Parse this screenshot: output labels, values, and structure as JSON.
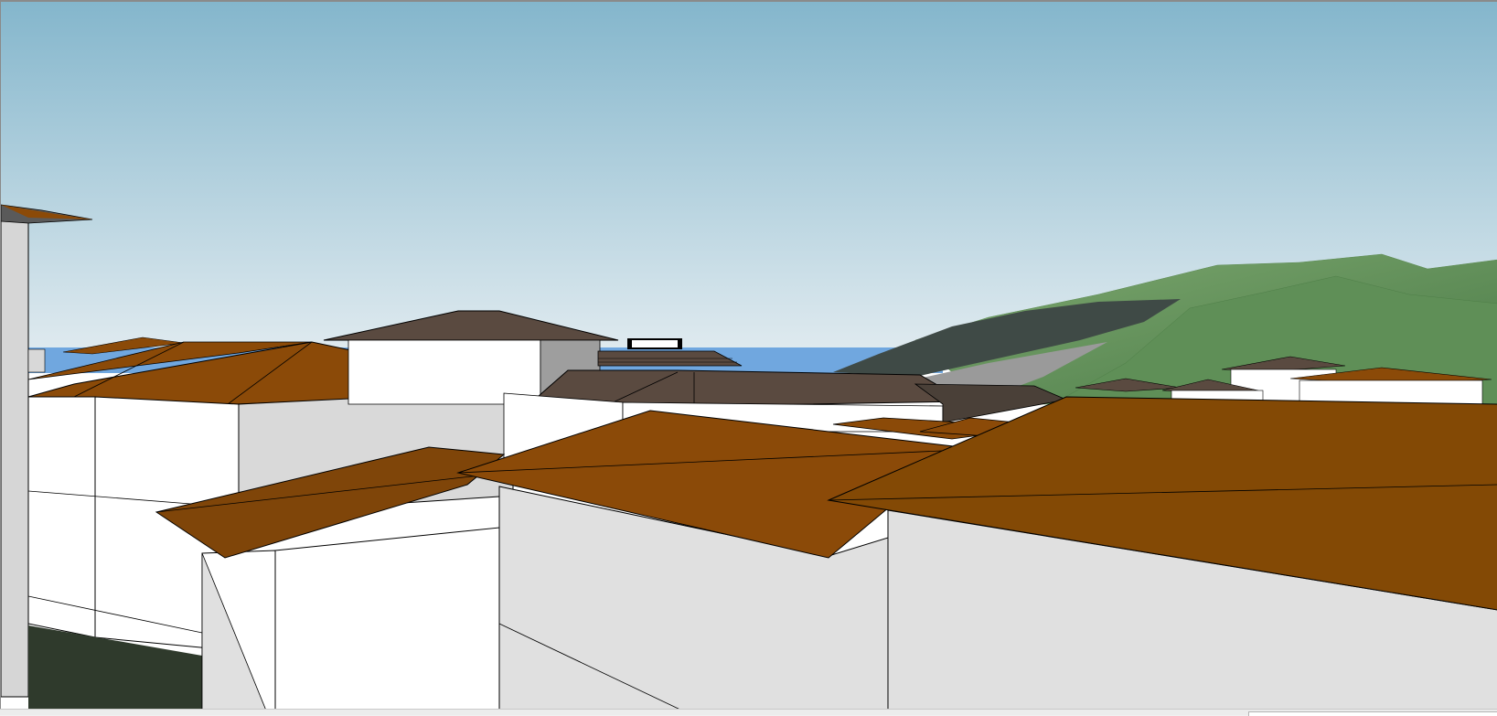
{
  "app": {
    "view": "3d-model-viewport"
  },
  "colors": {
    "sky_top": "#86b7cd",
    "sky_bottom": "#dde9ee",
    "sea": "#6fa6e0",
    "hill_light": "#6e9a62",
    "hill_dark": "#4c7a49",
    "roof_terracotta": "#8b4a08",
    "roof_gray": "#5a4a40",
    "wall_light": "#ffffff",
    "wall_shade": "#e0e0e0",
    "ground": "#2f3a2c"
  },
  "icons": {
    "status_field": "statusbar-field"
  }
}
